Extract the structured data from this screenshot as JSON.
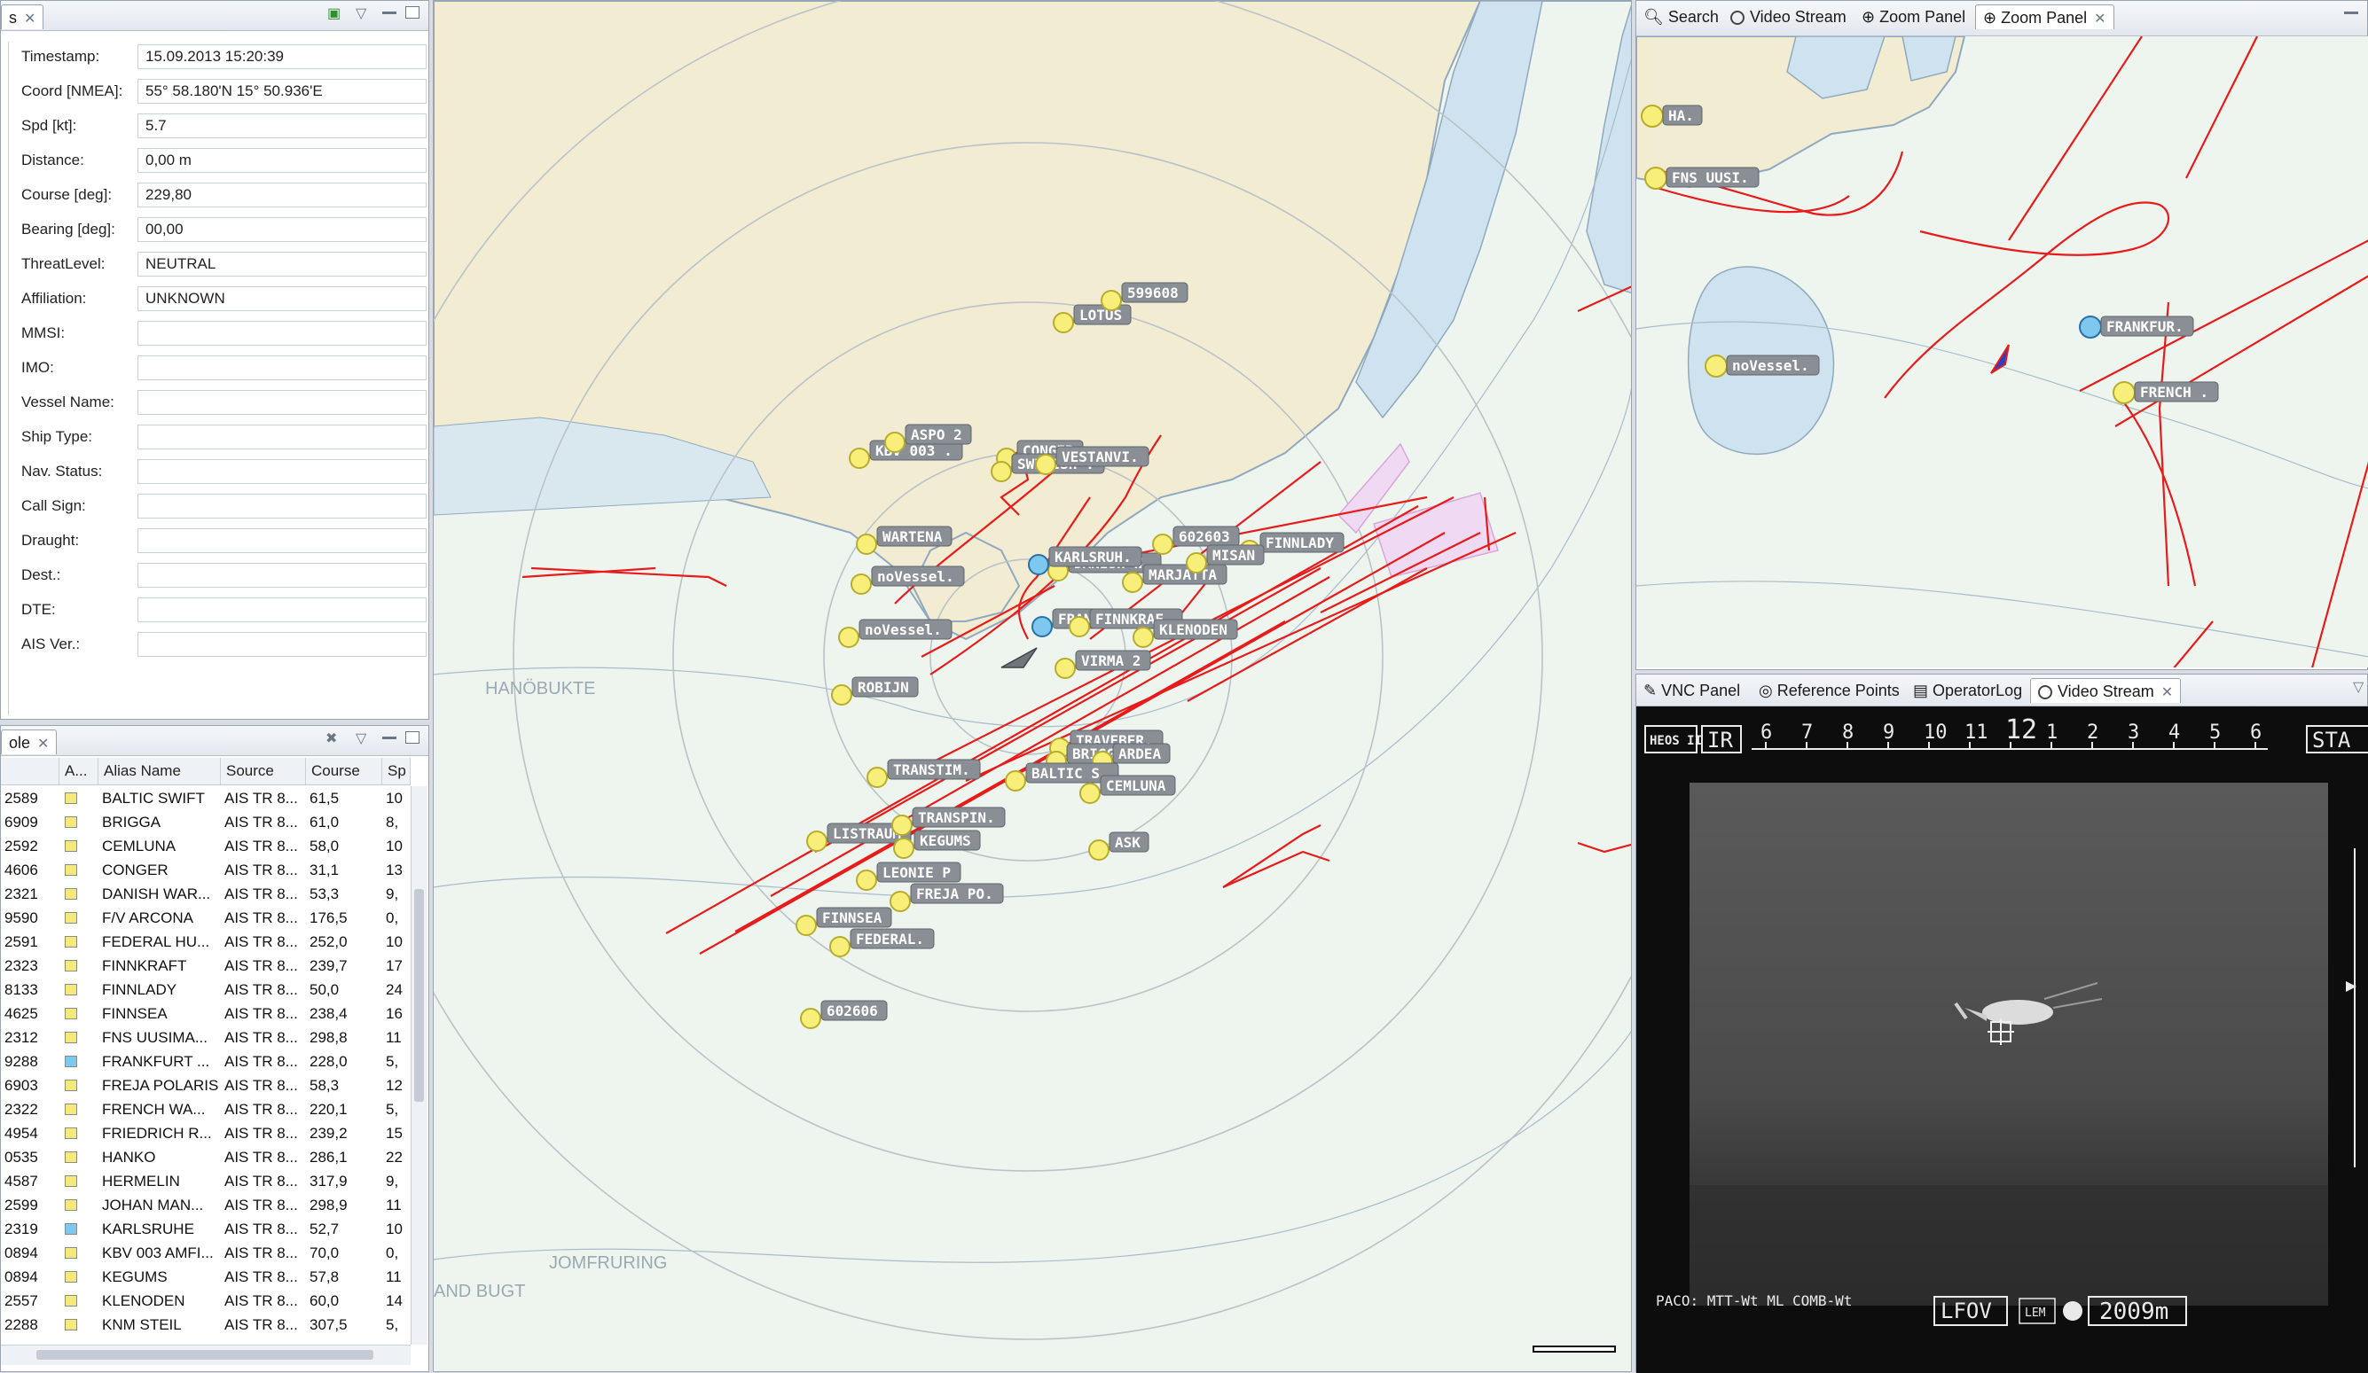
{
  "properties": {
    "tab_label": "s",
    "rows": [
      {
        "label": "Timestamp:",
        "value": "15.09.2013 15:20:39"
      },
      {
        "label": "Coord [NMEA]:",
        "value": "55° 58.180'N  15° 50.936'E"
      },
      {
        "label": "Spd [kt]:",
        "value": "5.7"
      },
      {
        "label": "Distance:",
        "value": "0,00 m"
      },
      {
        "label": "Course [deg]:",
        "value": "229,80"
      },
      {
        "label": "Bearing [deg]:",
        "value": "00,00"
      },
      {
        "label": "ThreatLevel:",
        "value": "NEUTRAL"
      },
      {
        "label": "Affiliation:",
        "value": "UNKNOWN"
      },
      {
        "label": "MMSI:",
        "value": ""
      },
      {
        "label": "IMO:",
        "value": ""
      },
      {
        "label": "Vessel Name:",
        "value": ""
      },
      {
        "label": "Ship Type:",
        "value": ""
      },
      {
        "label": "Nav. Status:",
        "value": ""
      },
      {
        "label": "Call Sign:",
        "value": ""
      },
      {
        "label": "Draught:",
        "value": ""
      },
      {
        "label": "Dest.:",
        "value": ""
      },
      {
        "label": "DTE:",
        "value": ""
      },
      {
        "label": "AIS Ver.:",
        "value": ""
      }
    ]
  },
  "table": {
    "tab_label": "ole",
    "columns": [
      "A...",
      "Alias Name",
      "Source",
      "Course",
      "Sp"
    ],
    "rows": [
      {
        "id": "2589",
        "alias": "BALTIC SWIFT",
        "source": "AIS TR 8...",
        "course": "61,5",
        "sp": "10",
        "flag": "#f4e97a"
      },
      {
        "id": "6909",
        "alias": "BRIGGA",
        "source": "AIS TR 8...",
        "course": "61,0",
        "sp": "8,",
        "flag": "#f4e97a"
      },
      {
        "id": "2592",
        "alias": "CEMLUNA",
        "source": "AIS TR 8...",
        "course": "58,0",
        "sp": "10",
        "flag": "#f4e97a"
      },
      {
        "id": "4606",
        "alias": "CONGER",
        "source": "AIS TR 8...",
        "course": "31,1",
        "sp": "13",
        "flag": "#f4e97a"
      },
      {
        "id": "2321",
        "alias": "DANISH WAR...",
        "source": "AIS TR 8...",
        "course": "53,3",
        "sp": "9,",
        "flag": "#f4e97a"
      },
      {
        "id": "9590",
        "alias": "F/V ARCONA",
        "source": "AIS TR 8...",
        "course": "176,5",
        "sp": "0,",
        "flag": "#f4e97a"
      },
      {
        "id": "2591",
        "alias": "FEDERAL HU...",
        "source": "AIS TR 8...",
        "course": "252,0",
        "sp": "10",
        "flag": "#f4e97a"
      },
      {
        "id": "2323",
        "alias": "FINNKRAFT",
        "source": "AIS TR 8...",
        "course": "239,7",
        "sp": "17",
        "flag": "#f4e97a"
      },
      {
        "id": "8133",
        "alias": "FINNLADY",
        "source": "AIS TR 8...",
        "course": "50,0",
        "sp": "24",
        "flag": "#f4e97a"
      },
      {
        "id": "4625",
        "alias": "FINNSEA",
        "source": "AIS TR 8...",
        "course": "238,4",
        "sp": "16",
        "flag": "#f4e97a"
      },
      {
        "id": "2312",
        "alias": "FNS UUSIMA...",
        "source": "AIS TR 8...",
        "course": "298,8",
        "sp": "11",
        "flag": "#f4e97a"
      },
      {
        "id": "9288",
        "alias": "FRANKFURT ...",
        "source": "AIS TR 8...",
        "course": "228,0",
        "sp": "5,",
        "flag": "#7cc8ee"
      },
      {
        "id": "6903",
        "alias": "FREJA POLARIS",
        "source": "AIS TR 8...",
        "course": "58,3",
        "sp": "12",
        "flag": "#f4e97a"
      },
      {
        "id": "2322",
        "alias": "FRENCH WA...",
        "source": "AIS TR 8...",
        "course": "220,1",
        "sp": "5,",
        "flag": "#f4e97a"
      },
      {
        "id": "4954",
        "alias": "FRIEDRICH R...",
        "source": "AIS TR 8...",
        "course": "239,2",
        "sp": "15",
        "flag": "#f4e97a"
      },
      {
        "id": "0535",
        "alias": "HANKO",
        "source": "AIS TR 8...",
        "course": "286,1",
        "sp": "22",
        "flag": "#f4e97a"
      },
      {
        "id": "4587",
        "alias": "HERMELIN",
        "source": "AIS TR 8...",
        "course": "317,9",
        "sp": "9,",
        "flag": "#f4e97a"
      },
      {
        "id": "2599",
        "alias": "JOHAN MAN...",
        "source": "AIS TR 8...",
        "course": "298,9",
        "sp": "11",
        "flag": "#f4e97a"
      },
      {
        "id": "2319",
        "alias": "KARLSRUHE",
        "source": "AIS TR 8...",
        "course": "52,7",
        "sp": "10",
        "flag": "#7cc8ee"
      },
      {
        "id": "0894",
        "alias": "KBV 003 AMFI...",
        "source": "AIS TR 8...",
        "course": "70,0",
        "sp": "0,",
        "flag": "#f4e97a"
      },
      {
        "id": "0894",
        "alias": "KEGUMS",
        "source": "AIS TR 8...",
        "course": "57,8",
        "sp": "11",
        "flag": "#f4e97a"
      },
      {
        "id": "2557",
        "alias": "KLENODEN",
        "source": "AIS TR 8...",
        "course": "60,0",
        "sp": "14",
        "flag": "#f4e97a"
      },
      {
        "id": "2288",
        "alias": "KNM STEIL",
        "source": "AIS TR 8...",
        "course": "307,5",
        "sp": "5,",
        "flag": "#f4e97a"
      }
    ]
  },
  "map": {
    "place_labels": [
      "HANÖBUKTE",
      "JOMFRURING",
      "AND BUGT"
    ],
    "targets": [
      {
        "label": "KBV 003 .",
        "type": "yellow"
      },
      {
        "label": "ASPO 2",
        "type": "yellow"
      },
      {
        "label": "LOTUS",
        "type": "yellow"
      },
      {
        "label": "599608",
        "type": "yellow"
      },
      {
        "label": "CONGER",
        "type": "yellow"
      },
      {
        "label": "SWEDISH .",
        "type": "yellow"
      },
      {
        "label": "VESTANVI.",
        "type": "yellow"
      },
      {
        "label": "WARTENA",
        "type": "yellow"
      },
      {
        "label": "noVessel.",
        "type": "yellow"
      },
      {
        "label": "DANISH W.",
        "type": "yellow"
      },
      {
        "label": "KARLSRUH.",
        "type": "blue"
      },
      {
        "label": "602603",
        "type": "yellow"
      },
      {
        "label": "FINNLADY",
        "type": "yellow"
      },
      {
        "label": "MARJATTA",
        "type": "yellow"
      },
      {
        "label": "MISAN",
        "type": "yellow"
      },
      {
        "label": "noVessel.",
        "type": "yellow"
      },
      {
        "label": "FRANKFUR.",
        "type": "blue"
      },
      {
        "label": "FINNKRAF.",
        "type": "yellow"
      },
      {
        "label": "KLENODEN",
        "type": "yellow"
      },
      {
        "label": "VIRMA 2",
        "type": "yellow"
      },
      {
        "label": "ROBIJN",
        "type": "yellow"
      },
      {
        "label": "TRAVEBER.",
        "type": "yellow"
      },
      {
        "label": "BRIGGA",
        "type": "yellow"
      },
      {
        "label": "ARDEA",
        "type": "yellow"
      },
      {
        "label": "BALTIC S.",
        "type": "yellow"
      },
      {
        "label": "CEMLUNA",
        "type": "yellow"
      },
      {
        "label": "TRANSTIM.",
        "type": "yellow"
      },
      {
        "label": "LISTRAUM",
        "type": "yellow"
      },
      {
        "label": "TRANSPIN.",
        "type": "yellow"
      },
      {
        "label": "KEGUMS",
        "type": "yellow"
      },
      {
        "label": "ASK",
        "type": "yellow"
      },
      {
        "label": "LEONIE P",
        "type": "yellow"
      },
      {
        "label": "FREJA PO.",
        "type": "yellow"
      },
      {
        "label": "FINNSEA",
        "type": "yellow"
      },
      {
        "label": "FEDERAL.",
        "type": "yellow"
      },
      {
        "label": "602606",
        "type": "yellow"
      }
    ]
  },
  "top_right": {
    "tabs": [
      "Search",
      "Video Stream",
      "Zoom Panel",
      "Zoom Panel"
    ],
    "labels": [
      "HA.",
      "FNS UUSI.",
      "noVessel.",
      "FRANKFUR.",
      "FRENCH ."
    ]
  },
  "bottom_right": {
    "tabs": [
      "VNC Panel",
      "Reference Points",
      "OperatorLog",
      "Video Stream"
    ],
    "osd": {
      "mode": "IR",
      "scale": [
        "6",
        "7",
        "8",
        "9",
        "10",
        "11",
        "12",
        "1",
        "2",
        "3",
        "4",
        "5",
        "6"
      ],
      "top_right": "STA",
      "bottom_left": "PACO: MTT-Wt ML",
      "bottom_mid": "COMB-Wt",
      "fov": "LFOV",
      "lem": "LEM",
      "range": "2009m",
      "logo": "HEOS II"
    }
  },
  "colors": {
    "track": "#e81b1b",
    "target": "#f7ef7a",
    "friendly": "#7cc8ee",
    "land": "#f2ecd3",
    "sea": "#eef5ef"
  }
}
